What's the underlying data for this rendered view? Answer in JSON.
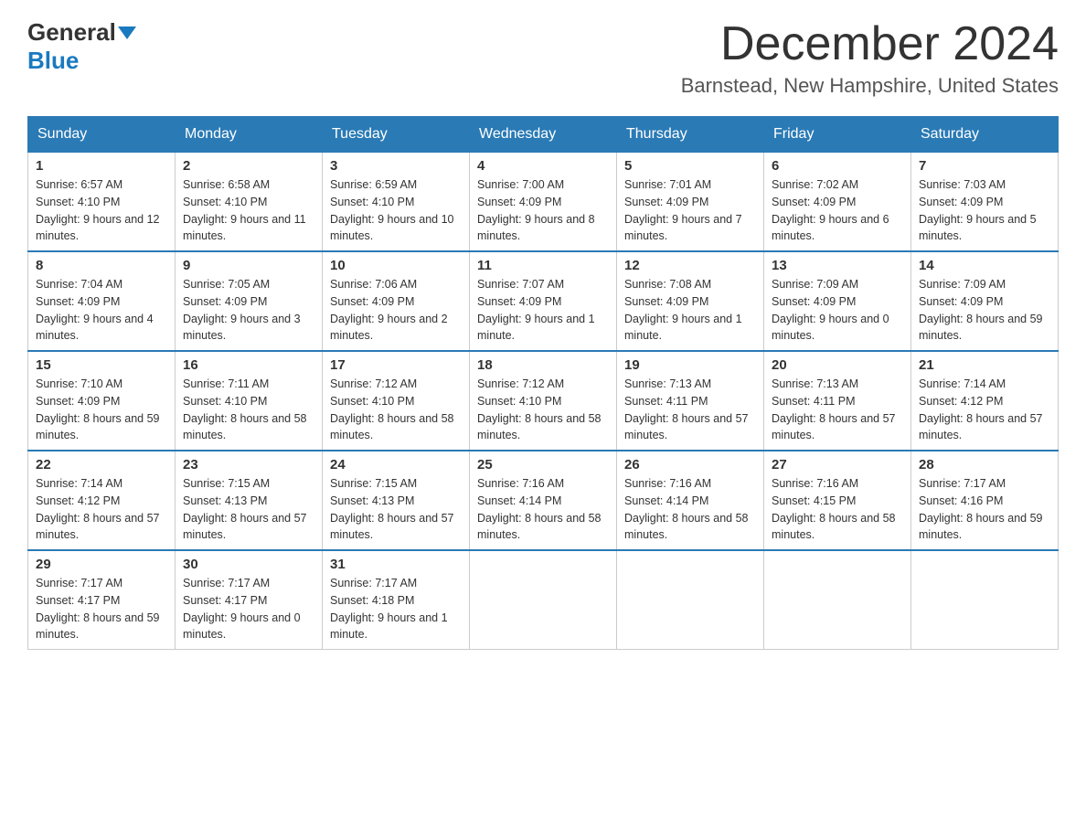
{
  "header": {
    "logo_general": "General",
    "logo_blue": "Blue",
    "month_title": "December 2024",
    "location": "Barnstead, New Hampshire, United States"
  },
  "days_of_week": [
    "Sunday",
    "Monday",
    "Tuesday",
    "Wednesday",
    "Thursday",
    "Friday",
    "Saturday"
  ],
  "weeks": [
    [
      {
        "day": "1",
        "sunrise": "6:57 AM",
        "sunset": "4:10 PM",
        "daylight": "9 hours and 12 minutes."
      },
      {
        "day": "2",
        "sunrise": "6:58 AM",
        "sunset": "4:10 PM",
        "daylight": "9 hours and 11 minutes."
      },
      {
        "day": "3",
        "sunrise": "6:59 AM",
        "sunset": "4:10 PM",
        "daylight": "9 hours and 10 minutes."
      },
      {
        "day": "4",
        "sunrise": "7:00 AM",
        "sunset": "4:09 PM",
        "daylight": "9 hours and 8 minutes."
      },
      {
        "day": "5",
        "sunrise": "7:01 AM",
        "sunset": "4:09 PM",
        "daylight": "9 hours and 7 minutes."
      },
      {
        "day": "6",
        "sunrise": "7:02 AM",
        "sunset": "4:09 PM",
        "daylight": "9 hours and 6 minutes."
      },
      {
        "day": "7",
        "sunrise": "7:03 AM",
        "sunset": "4:09 PM",
        "daylight": "9 hours and 5 minutes."
      }
    ],
    [
      {
        "day": "8",
        "sunrise": "7:04 AM",
        "sunset": "4:09 PM",
        "daylight": "9 hours and 4 minutes."
      },
      {
        "day": "9",
        "sunrise": "7:05 AM",
        "sunset": "4:09 PM",
        "daylight": "9 hours and 3 minutes."
      },
      {
        "day": "10",
        "sunrise": "7:06 AM",
        "sunset": "4:09 PM",
        "daylight": "9 hours and 2 minutes."
      },
      {
        "day": "11",
        "sunrise": "7:07 AM",
        "sunset": "4:09 PM",
        "daylight": "9 hours and 1 minute."
      },
      {
        "day": "12",
        "sunrise": "7:08 AM",
        "sunset": "4:09 PM",
        "daylight": "9 hours and 1 minute."
      },
      {
        "day": "13",
        "sunrise": "7:09 AM",
        "sunset": "4:09 PM",
        "daylight": "9 hours and 0 minutes."
      },
      {
        "day": "14",
        "sunrise": "7:09 AM",
        "sunset": "4:09 PM",
        "daylight": "8 hours and 59 minutes."
      }
    ],
    [
      {
        "day": "15",
        "sunrise": "7:10 AM",
        "sunset": "4:09 PM",
        "daylight": "8 hours and 59 minutes."
      },
      {
        "day": "16",
        "sunrise": "7:11 AM",
        "sunset": "4:10 PM",
        "daylight": "8 hours and 58 minutes."
      },
      {
        "day": "17",
        "sunrise": "7:12 AM",
        "sunset": "4:10 PM",
        "daylight": "8 hours and 58 minutes."
      },
      {
        "day": "18",
        "sunrise": "7:12 AM",
        "sunset": "4:10 PM",
        "daylight": "8 hours and 58 minutes."
      },
      {
        "day": "19",
        "sunrise": "7:13 AM",
        "sunset": "4:11 PM",
        "daylight": "8 hours and 57 minutes."
      },
      {
        "day": "20",
        "sunrise": "7:13 AM",
        "sunset": "4:11 PM",
        "daylight": "8 hours and 57 minutes."
      },
      {
        "day": "21",
        "sunrise": "7:14 AM",
        "sunset": "4:12 PM",
        "daylight": "8 hours and 57 minutes."
      }
    ],
    [
      {
        "day": "22",
        "sunrise": "7:14 AM",
        "sunset": "4:12 PM",
        "daylight": "8 hours and 57 minutes."
      },
      {
        "day": "23",
        "sunrise": "7:15 AM",
        "sunset": "4:13 PM",
        "daylight": "8 hours and 57 minutes."
      },
      {
        "day": "24",
        "sunrise": "7:15 AM",
        "sunset": "4:13 PM",
        "daylight": "8 hours and 57 minutes."
      },
      {
        "day": "25",
        "sunrise": "7:16 AM",
        "sunset": "4:14 PM",
        "daylight": "8 hours and 58 minutes."
      },
      {
        "day": "26",
        "sunrise": "7:16 AM",
        "sunset": "4:14 PM",
        "daylight": "8 hours and 58 minutes."
      },
      {
        "day": "27",
        "sunrise": "7:16 AM",
        "sunset": "4:15 PM",
        "daylight": "8 hours and 58 minutes."
      },
      {
        "day": "28",
        "sunrise": "7:17 AM",
        "sunset": "4:16 PM",
        "daylight": "8 hours and 59 minutes."
      }
    ],
    [
      {
        "day": "29",
        "sunrise": "7:17 AM",
        "sunset": "4:17 PM",
        "daylight": "8 hours and 59 minutes."
      },
      {
        "day": "30",
        "sunrise": "7:17 AM",
        "sunset": "4:17 PM",
        "daylight": "9 hours and 0 minutes."
      },
      {
        "day": "31",
        "sunrise": "7:17 AM",
        "sunset": "4:18 PM",
        "daylight": "9 hours and 1 minute."
      },
      null,
      null,
      null,
      null
    ]
  ],
  "labels": {
    "sunrise": "Sunrise:",
    "sunset": "Sunset:",
    "daylight": "Daylight:"
  }
}
